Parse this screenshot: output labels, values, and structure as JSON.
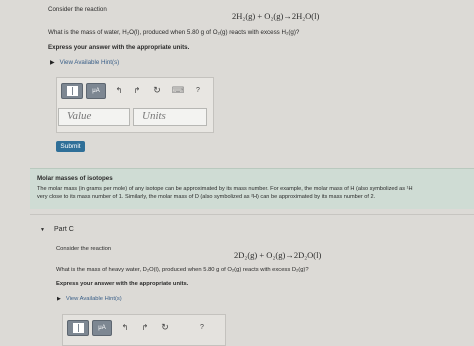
{
  "partB": {
    "intro": "Consider the reaction",
    "reaction": "2H₂(g) + O₂(g)→2H₂O(l)",
    "question": "What is the mass of water, H₂O(l), produced when 5.80 g of O₂(g) reacts with excess H₂(g)?",
    "instruction": "Express your answer with the appropriate units.",
    "hints_label": "View Available Hint(s)",
    "toolbar": {
      "templates_label": "",
      "micro_label": "μA",
      "undo": "↰",
      "redo": "↱",
      "reset": "↻",
      "keyboard": "⌨",
      "help": "?"
    },
    "value_placeholder": "Value",
    "units_placeholder": "Units",
    "submit_label": "Submit"
  },
  "info_box": {
    "title": "Molar masses of isotopes",
    "text_line1": "The molar mass (in grams per mole) of any isotope can be approximated by its mass number. For example, the molar mass of H (also symbolized as ¹H",
    "text_line2": "very close to its mass number of 1. Similarly, the molar mass of D (also symbolized as ²H) can be approximated by its mass number of 2."
  },
  "partC": {
    "caret": "▼",
    "label": "Part C",
    "intro": "Consider the reaction",
    "reaction": "2D₂(g) + O₂(g)→2D₂O(l)",
    "question": "What is the mass of heavy water, D₂O(l), produced when 5.80 g of O₂(g) reacts with excess D₂(g)?",
    "instruction": "Express your answer with the appropriate units.",
    "hints_label": "View Available Hint(s)",
    "toolbar": {
      "micro_label": "μA",
      "undo": "↰",
      "redo": "↱",
      "reset": "↻",
      "help": "?"
    }
  }
}
